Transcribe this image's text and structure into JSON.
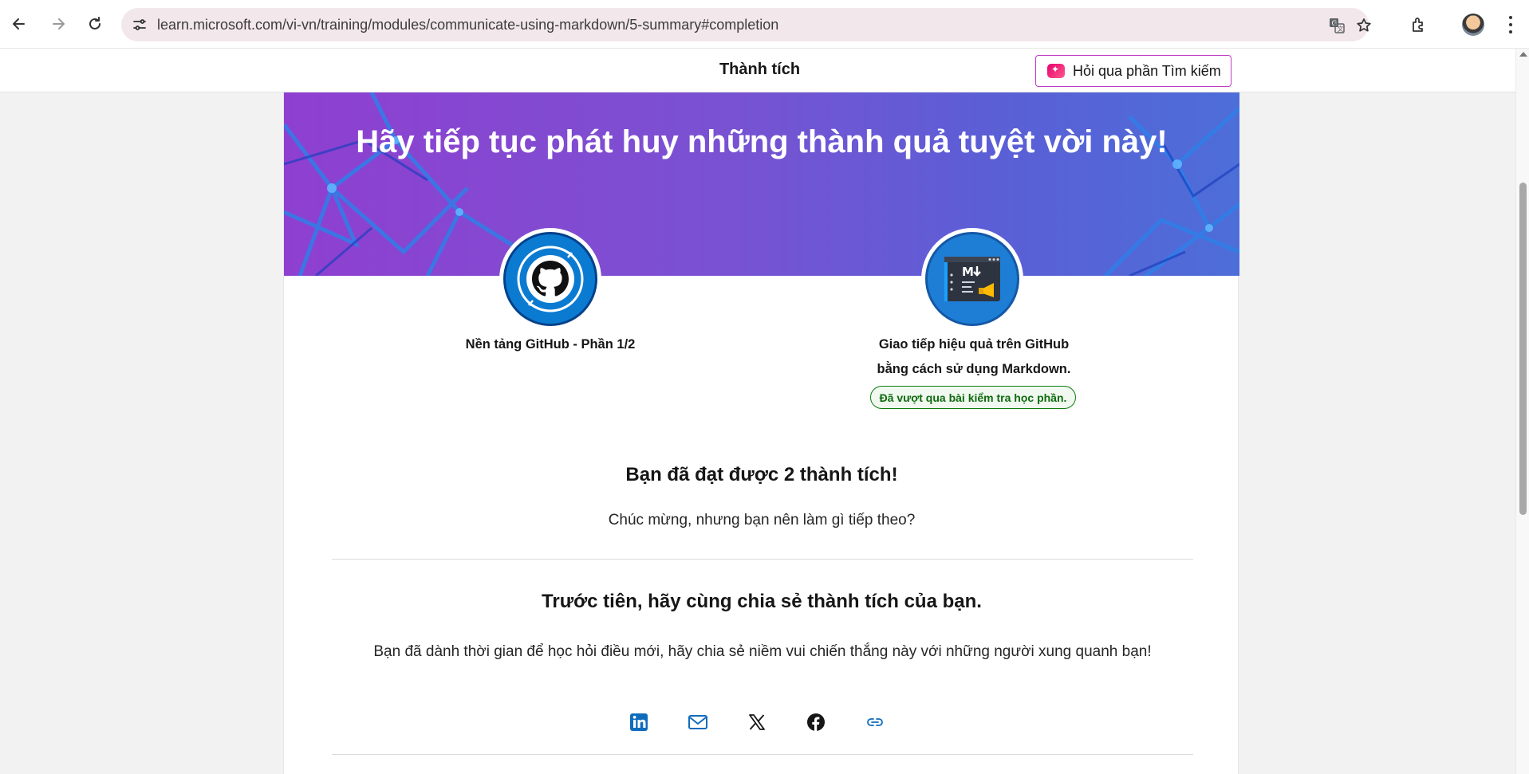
{
  "browser": {
    "url": "learn.microsoft.com/vi-vn/training/modules/communicate-using-markdown/5-summary#completion",
    "icons": [
      "back-icon",
      "forward-icon",
      "reload-icon",
      "site-info-icon",
      "translate-icon",
      "star-icon",
      "extensions-icon",
      "avatar",
      "menu-icon"
    ]
  },
  "header": {
    "title": "Thành tích",
    "ask_button": "Hỏi qua phần Tìm kiếm"
  },
  "banner": {
    "headline": "Hãy tiếp tục phát huy những thành quả tuyệt vời này!"
  },
  "achievements": [
    {
      "label": "Nền tảng GitHub - Phần 1/2",
      "icon": "github-badge-icon"
    },
    {
      "label_line1": "Giao tiếp hiệu quả trên GitHub",
      "label_line2": "bằng cách sử dụng Markdown.",
      "status": "Đã vượt qua bài kiểm tra học phần.",
      "icon": "markdown-badge-icon"
    }
  ],
  "summary": {
    "heading": "Bạn đã đạt được 2 thành tích!",
    "text": "Chúc mừng, nhưng bạn nên làm gì tiếp theo?"
  },
  "share": {
    "heading": "Trước tiên, hãy cùng chia sẻ thành tích của bạn.",
    "text": "Bạn đã dành thời gian để học hỏi điều mới, hãy chia sẻ niềm vui chiến thắng này với những người xung quanh bạn!",
    "buttons": [
      "linkedin-icon",
      "email-icon",
      "x-icon",
      "facebook-icon",
      "link-icon"
    ]
  },
  "colors": {
    "accent_link": "#0f6cbd",
    "ask_border": "#c03bc4",
    "pass_green": "#107c10",
    "banner_left": "#8f3fd0",
    "banner_right": "#4d6ed8"
  }
}
